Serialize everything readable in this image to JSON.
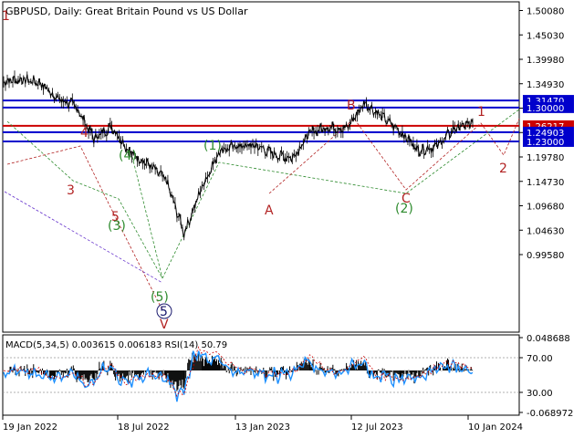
{
  "chart": {
    "symbol_header": "GBPUSD, Daily:  Great Britain Pound vs US Dollar",
    "price_ticks": [
      "1.50080",
      "1.45030",
      "1.39980",
      "1.34930",
      "1.29880",
      "1.24830",
      "1.19780",
      "1.14730",
      "1.09680",
      "1.04630",
      "0.99580"
    ],
    "date_ticks": [
      "19 Jan 2022",
      "18 Jul 2022",
      "13 Jan 2023",
      "12 Jul 2023",
      "10 Jan 2024"
    ],
    "indicator_header": "MACD(5,34,5) 0.003615 0.006183 RSI(14) 50.79",
    "indicator_ticks": [
      "0.048688",
      "70.00",
      "30.00",
      "-0.068972"
    ],
    "price_tags": [
      {
        "label": "1.31470",
        "style": "blue-box"
      },
      {
        "label": "1.30000",
        "style": "blue-box"
      },
      {
        "label": "1.26217",
        "style": "red-box"
      },
      {
        "label": "1.24903",
        "style": "blue-box"
      },
      {
        "label": "1.23000",
        "style": "blue-box"
      }
    ],
    "wave_labels": [
      {
        "text": "1",
        "color": "#b22222"
      },
      {
        "text": "4",
        "color": "#b22222"
      },
      {
        "text": "3",
        "color": "#b22222"
      },
      {
        "text": "5",
        "color": "#b22222"
      },
      {
        "text": "(4)",
        "color": "#2e8b2e"
      },
      {
        "text": "(3)",
        "color": "#2e8b2e"
      },
      {
        "text": "(1)",
        "color": "#2e8b2e"
      },
      {
        "text": "(5)",
        "color": "#2e8b2e"
      },
      {
        "text": "5",
        "color": "#1a1a6e"
      },
      {
        "text": "V",
        "color": "#b22222"
      },
      {
        "text": "A",
        "color": "#b22222"
      },
      {
        "text": "B",
        "color": "#b22222"
      },
      {
        "text": "C",
        "color": "#b22222"
      },
      {
        "text": "(2)",
        "color": "#2e8b2e"
      },
      {
        "text": "1",
        "color": "#b22222"
      },
      {
        "text": "2",
        "color": "#b22222"
      }
    ]
  },
  "chart_data": {
    "type": "line",
    "title": "GBPUSD, Daily:  Great Britain Pound vs US Dollar",
    "xlabel": "",
    "ylabel": "",
    "ylim": [
      0.97,
      1.515
    ],
    "x": [
      "2021-12",
      "2022-01",
      "2022-02",
      "2022-03",
      "2022-04",
      "2022-05",
      "2022-06",
      "2022-07",
      "2022-08",
      "2022-09",
      "2022-09-26",
      "2022-10",
      "2022-11",
      "2022-12",
      "2023-01",
      "2023-02",
      "2023-03",
      "2023-04",
      "2023-05",
      "2023-06",
      "2023-07",
      "2023-08",
      "2023-09",
      "2023-10",
      "2023-11",
      "2023-12",
      "2024-01"
    ],
    "series": [
      {
        "values": [
          1.355,
          1.358,
          1.352,
          1.318,
          1.303,
          1.236,
          1.261,
          1.207,
          1.183,
          1.15,
          1.04,
          1.137,
          1.213,
          1.22,
          1.221,
          1.203,
          1.196,
          1.249,
          1.26,
          1.256,
          1.31,
          1.28,
          1.25,
          1.212,
          1.22,
          1.257,
          1.268
        ]
      }
    ],
    "horizontal_levels": {
      "blue": [
        1.3147,
        1.3,
        1.24903,
        1.23
      ],
      "red": [
        1.26217
      ]
    },
    "indicator": {
      "macd": {
        "name": "MACD(5,34,5)",
        "main": 0.003615,
        "signal": 0.006183,
        "range": [
          -0.068972,
          0.048688
        ]
      },
      "rsi": {
        "name": "RSI(14)",
        "value": 50.79,
        "levels": [
          70.0,
          30.0
        ]
      }
    },
    "grid": false
  }
}
